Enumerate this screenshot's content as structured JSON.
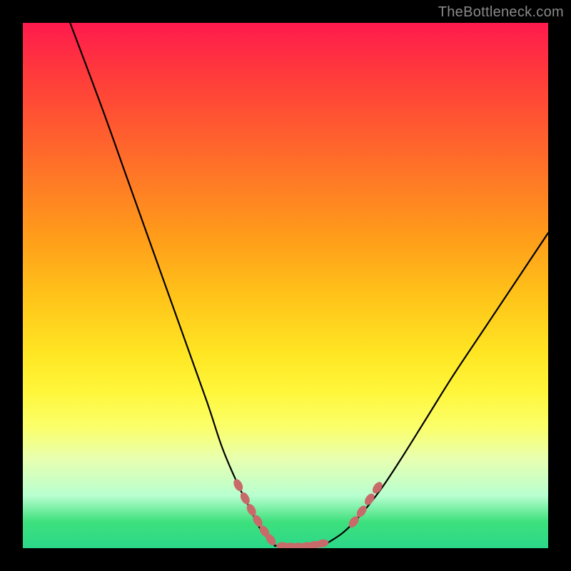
{
  "watermark": "TheBottleneck.com",
  "chart_data": {
    "type": "line",
    "title": "",
    "xlabel": "",
    "ylabel": "",
    "xlim": [
      0,
      100
    ],
    "ylim": [
      0,
      100
    ],
    "series": [
      {
        "name": "curve-left",
        "x": [
          9,
          15,
          20,
          25,
          30,
          35,
          38,
          41,
          43,
          45,
          46.5,
          48
        ],
        "y": [
          100,
          84,
          70,
          56,
          42,
          28,
          19,
          12,
          8,
          4,
          2,
          0.5
        ]
      },
      {
        "name": "curve-bottom",
        "x": [
          48,
          50,
          52,
          54,
          56,
          58
        ],
        "y": [
          0.5,
          0.2,
          0.2,
          0.3,
          0.5,
          1.0
        ]
      },
      {
        "name": "curve-right",
        "x": [
          58,
          61,
          64,
          68,
          72,
          77,
          82,
          88,
          94,
          100
        ],
        "y": [
          1.0,
          3,
          6,
          11,
          17,
          25,
          33,
          42,
          51,
          60
        ]
      }
    ],
    "beads": {
      "left": [
        [
          41,
          12
        ],
        [
          42.3,
          9.5
        ],
        [
          43.5,
          7.3
        ],
        [
          44.7,
          5.2
        ],
        [
          46,
          3.2
        ],
        [
          47.2,
          1.6
        ]
      ],
      "bottom": [
        [
          49.5,
          0.4
        ],
        [
          51,
          0.3
        ],
        [
          52.5,
          0.3
        ],
        [
          54,
          0.4
        ],
        [
          55.5,
          0.6
        ],
        [
          57,
          0.9
        ]
      ],
      "right": [
        [
          63,
          5
        ],
        [
          64.5,
          7
        ],
        [
          66,
          9.3
        ],
        [
          67.5,
          11.5
        ]
      ]
    },
    "gradient_stops": [
      {
        "pos": 0,
        "color": "#ff1a4d"
      },
      {
        "pos": 25,
        "color": "#ff6a2b"
      },
      {
        "pos": 52,
        "color": "#ffc319"
      },
      {
        "pos": 77,
        "color": "#fbff6a"
      },
      {
        "pos": 95,
        "color": "#3de07c"
      },
      {
        "pos": 100,
        "color": "#2bd889"
      }
    ]
  }
}
